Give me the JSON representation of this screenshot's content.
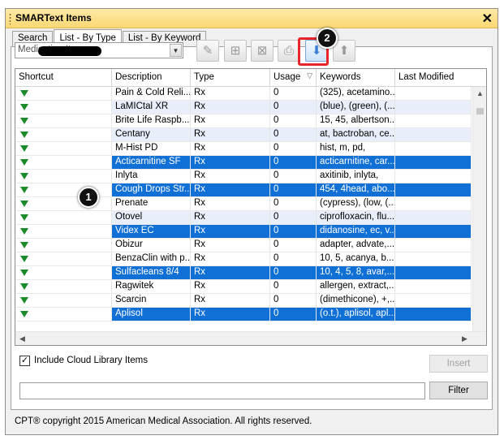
{
  "window": {
    "title": "SMARText Items"
  },
  "tabs": [
    {
      "label": "Search"
    },
    {
      "label": "List - By Type"
    },
    {
      "label": "List - By Keyword"
    }
  ],
  "type_combo": {
    "value": "Medication Item"
  },
  "toolbar_icons": [
    "edit-item-icon",
    "add-item-icon",
    "delete-item-icon",
    "print-icon",
    "move-down-icon",
    "move-up-icon"
  ],
  "markers": {
    "one": "1",
    "two": "2"
  },
  "grid": {
    "columns": [
      "Shortcut",
      "Description",
      "Type",
      "Usage",
      "Keywords",
      "Last Modified"
    ],
    "rows": [
      {
        "description": "Pain & Cold Reli...",
        "type": "Rx",
        "usage": "0",
        "keywords": "(325), acetamino...",
        "state": "normal"
      },
      {
        "description": "LaMICtal XR",
        "type": "Rx",
        "usage": "0",
        "keywords": "(blue), (green), (...",
        "state": "alt"
      },
      {
        "description": "Brite Life Raspb...",
        "type": "Rx",
        "usage": "0",
        "keywords": "15, 45, albertson...",
        "state": "normal"
      },
      {
        "description": "Centany",
        "type": "Rx",
        "usage": "0",
        "keywords": "at, bactroban, ce...",
        "state": "alt"
      },
      {
        "description": "M-Hist PD",
        "type": "Rx",
        "usage": "0",
        "keywords": "hist, m, pd,",
        "state": "normal"
      },
      {
        "description": "Acticarnitine SF",
        "type": "Rx",
        "usage": "0",
        "keywords": "acticarnitine, car...",
        "state": "sel"
      },
      {
        "description": "Inlyta",
        "type": "Rx",
        "usage": "0",
        "keywords": "axitinib, inlyta,",
        "state": "normal"
      },
      {
        "description": "Cough Drops Str...",
        "type": "Rx",
        "usage": "0",
        "keywords": "454, 4head, abo...",
        "state": "sel"
      },
      {
        "description": "Prenate",
        "type": "Rx",
        "usage": "0",
        "keywords": "(cypress), (low, (...",
        "state": "normal"
      },
      {
        "description": "Otovel",
        "type": "Rx",
        "usage": "0",
        "keywords": "ciprofloxacin, flu...",
        "state": "alt"
      },
      {
        "description": "Videx EC",
        "type": "Rx",
        "usage": "0",
        "keywords": "didanosine, ec, v...",
        "state": "sel"
      },
      {
        "description": "Obizur",
        "type": "Rx",
        "usage": "0",
        "keywords": "adapter, advate,...",
        "state": "normal"
      },
      {
        "description": "BenzaClin with p...",
        "type": "Rx",
        "usage": "0",
        "keywords": "10, 5, acanya, b...",
        "state": "normal"
      },
      {
        "description": "Sulfacleans 8/4",
        "type": "Rx",
        "usage": "0",
        "keywords": "10, 4, 5, 8, avar,...",
        "state": "sel"
      },
      {
        "description": "Ragwitek",
        "type": "Rx",
        "usage": "0",
        "keywords": "allergen, extract,...",
        "state": "normal"
      },
      {
        "description": "Scarcin",
        "type": "Rx",
        "usage": "0",
        "keywords": "(dimethicone), +,...",
        "state": "normal"
      },
      {
        "description": "Aplisol",
        "type": "Rx",
        "usage": "0",
        "keywords": "(o.t.), aplisol, apl...",
        "state": "sel"
      }
    ]
  },
  "include_cloud": {
    "label": "Include Cloud Library Items",
    "checked": true
  },
  "buttons": {
    "insert": "Insert",
    "filter": "Filter"
  },
  "filter_input": {
    "value": ""
  },
  "footer": {
    "text": "CPT® copyright 2015 American Medical Association. All rights reserved."
  },
  "colors": {
    "selection": "#1170d5",
    "alt_row": "#e8eefa",
    "title_bar": "#fbd874",
    "highlight": "#e8252b",
    "shortcut_arrow": "#1d8a2a"
  }
}
